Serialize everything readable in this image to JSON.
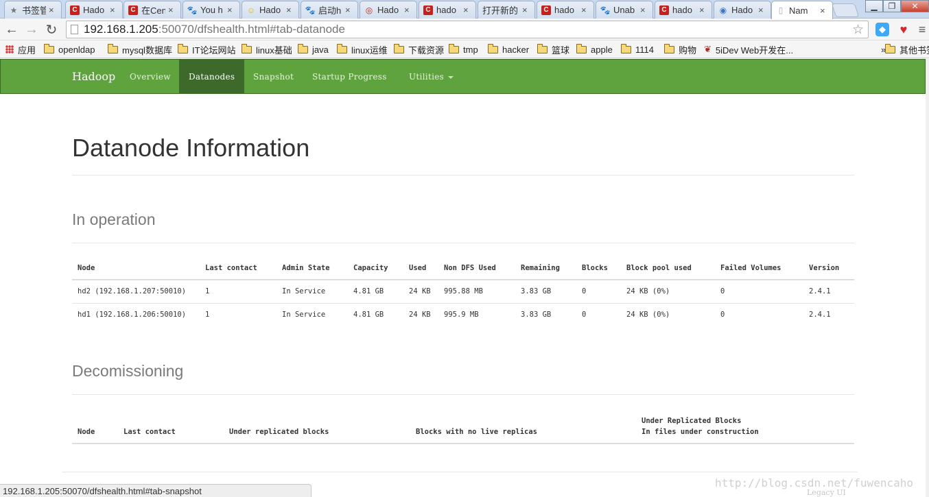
{
  "browser": {
    "tabs": [
      {
        "title": "书签管",
        "icon": "star-icon",
        "color": "#777777",
        "glyph": "★"
      },
      {
        "title": "Hado",
        "icon": "csdn-icon",
        "color": "#c8211c",
        "glyph": "C"
      },
      {
        "title": "在Cen",
        "icon": "csdn-icon",
        "color": "#c8211c",
        "glyph": "C"
      },
      {
        "title": "You h",
        "icon": "baidu-paw-icon",
        "color": "#2b5bd6",
        "glyph": "🐾"
      },
      {
        "title": "Hado",
        "icon": "smiley-icon",
        "color": "#e0b320",
        "glyph": "☺"
      },
      {
        "title": "启动h",
        "icon": "baidu-paw-icon",
        "color": "#2b5bd6",
        "glyph": "🐾"
      },
      {
        "title": "Hado",
        "icon": "circle-icon",
        "color": "#c8211c",
        "glyph": "◎"
      },
      {
        "title": "hado",
        "icon": "csdn-icon",
        "color": "#c8211c",
        "glyph": "C"
      },
      {
        "title": "打开新的",
        "icon": "none",
        "color": "",
        "glyph": ""
      },
      {
        "title": "hado",
        "icon": "csdn-icon",
        "color": "#c8211c",
        "glyph": "C"
      },
      {
        "title": "Unab",
        "icon": "baidu-paw-icon",
        "color": "#2b5bd6",
        "glyph": "🐾"
      },
      {
        "title": "hado",
        "icon": "csdn-icon",
        "color": "#c8211c",
        "glyph": "C"
      },
      {
        "title": "Hado",
        "icon": "globe-icon",
        "color": "#3a78c4",
        "glyph": "◉"
      },
      {
        "title": "Nam",
        "icon": "page-icon",
        "color": "#aaaaaa",
        "glyph": "▯",
        "active": true
      }
    ],
    "url_host": "192.168.1.205",
    "url_path": ":50070/dfshealth.html#tab-datanode",
    "bookmarks": [
      {
        "label": "应用",
        "type": "apps"
      },
      {
        "label": "openldap",
        "type": "folder"
      },
      {
        "label": "mysql数据库",
        "type": "folder"
      },
      {
        "label": "IT论坛网站",
        "type": "folder"
      },
      {
        "label": "linux基础",
        "type": "folder"
      },
      {
        "label": "java",
        "type": "folder"
      },
      {
        "label": "linux运维",
        "type": "folder"
      },
      {
        "label": "下载资源",
        "type": "folder"
      },
      {
        "label": "tmp",
        "type": "folder"
      },
      {
        "label": "hacker",
        "type": "folder"
      },
      {
        "label": "篮球",
        "type": "folder"
      },
      {
        "label": "apple",
        "type": "folder"
      },
      {
        "label": "1114",
        "type": "folder"
      },
      {
        "label": "购物",
        "type": "folder"
      },
      {
        "label": "5iDev Web开发在...",
        "type": "site"
      }
    ],
    "bookmarks_overflow": "»",
    "other_bookmarks": "其他书签",
    "status_url": "192.168.1.205:50070/dfshealth.html#tab-snapshot"
  },
  "nav": {
    "brand": "Hadoop",
    "links": [
      "Overview",
      "Datanodes",
      "Snapshot",
      "Startup Progress",
      "Utilities"
    ],
    "active": "Datanodes"
  },
  "page": {
    "title": "Datanode Information",
    "in_operation_heading": "In operation",
    "decom_heading": "Decomissioning"
  },
  "datanodes": {
    "columns": [
      "Node",
      "Last contact",
      "Admin State",
      "Capacity",
      "Used",
      "Non DFS Used",
      "Remaining",
      "Blocks",
      "Block pool used",
      "Failed Volumes",
      "Version"
    ],
    "rows": [
      [
        "hd2 (192.168.1.207:50010)",
        "1",
        "In Service",
        "4.81 GB",
        "24 KB",
        "995.88 MB",
        "3.83 GB",
        "0",
        "24 KB (0%)",
        "0",
        "2.4.1"
      ],
      [
        "hd1 (192.168.1.206:50010)",
        "1",
        "In Service",
        "4.81 GB",
        "24 KB",
        "995.9 MB",
        "3.83 GB",
        "0",
        "24 KB (0%)",
        "0",
        "2.4.1"
      ]
    ]
  },
  "decommissioning": {
    "columns": [
      "Node",
      "Last contact",
      "Under replicated blocks",
      "Blocks with no live replicas"
    ],
    "last_col_line1": "Under Replicated Blocks",
    "last_col_line2": "In files under construction"
  },
  "watermark": "http://blog.csdn.net/fuwencaho",
  "legacy_ui": "Legacy UI"
}
